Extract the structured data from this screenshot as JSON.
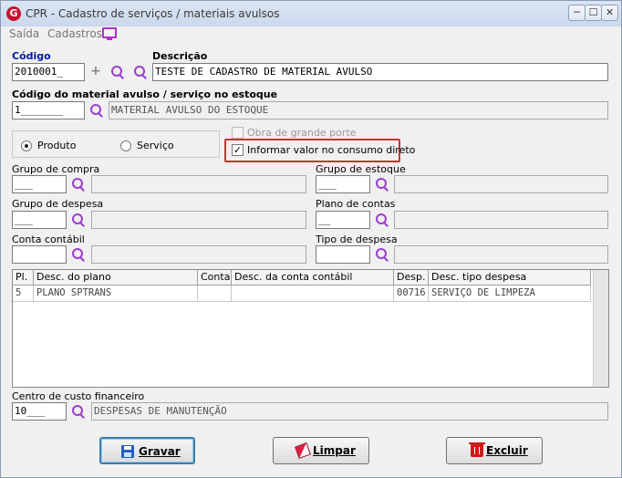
{
  "window": {
    "title": "CPR - Cadastro de serviços / materiais avulsos",
    "icon_letter": "G"
  },
  "titlebar_buttons": {
    "minimize": "─",
    "maximize": "☐",
    "close": "✕"
  },
  "menu": {
    "saida": "Saída",
    "cadastros": "Cadastros"
  },
  "codigo": {
    "label": "Código",
    "value": "2010001_"
  },
  "descricao": {
    "label": "Descrição",
    "value": "TESTE DE CADASTRO DE MATERIAL AVULSO"
  },
  "material_estoque": {
    "label": "Código do material avulso / serviço no estoque",
    "code": "1_______",
    "desc": "MATERIAL AVULSO DO ESTOQUE"
  },
  "tipo": {
    "produto": "Produto",
    "servico": "Serviço",
    "selected": "produto"
  },
  "obra_grande_porte": {
    "label": "Obra de grande porte",
    "checked": false,
    "enabled": false
  },
  "informar_valor": {
    "label": "Informar valor no consumo direto",
    "checked": true,
    "mark": "✓"
  },
  "grupo_compra": {
    "label": "Grupo de compra",
    "code": "___",
    "desc": ""
  },
  "grupo_estoque": {
    "label": "Grupo de estoque",
    "code": "___",
    "desc": ""
  },
  "grupo_despesa": {
    "label": "Grupo de despesa",
    "code": "___",
    "desc": ""
  },
  "plano_contas": {
    "label": "Plano de contas",
    "code": "__",
    "desc": ""
  },
  "conta_contabil": {
    "label": "Conta contábil",
    "code": "",
    "desc": ""
  },
  "tipo_despesa": {
    "label": "Tipo de despesa",
    "code": "",
    "desc": ""
  },
  "grid": {
    "headers": [
      "Pl.",
      "Desc. do plano",
      "Conta",
      "Desc. da conta contábil",
      "Desp.",
      "Desc. tipo despesa"
    ],
    "rows": [
      [
        "5",
        "PLANO SPTRANS",
        "",
        "",
        "00716",
        "SERVIÇO DE LIMPEZA"
      ]
    ]
  },
  "centro_custo": {
    "label": "Centro de custo financeiro",
    "code": "10___",
    "desc": "DESPESAS DE MANUTENÇÃO"
  },
  "buttons": {
    "gravar": "Gravar",
    "limpar": "Limpar",
    "excluir": "Excluir"
  },
  "colors": {
    "highlight": "#d03030",
    "label_blue": "#001a9c",
    "accent_icon": "#9a3fd0"
  }
}
